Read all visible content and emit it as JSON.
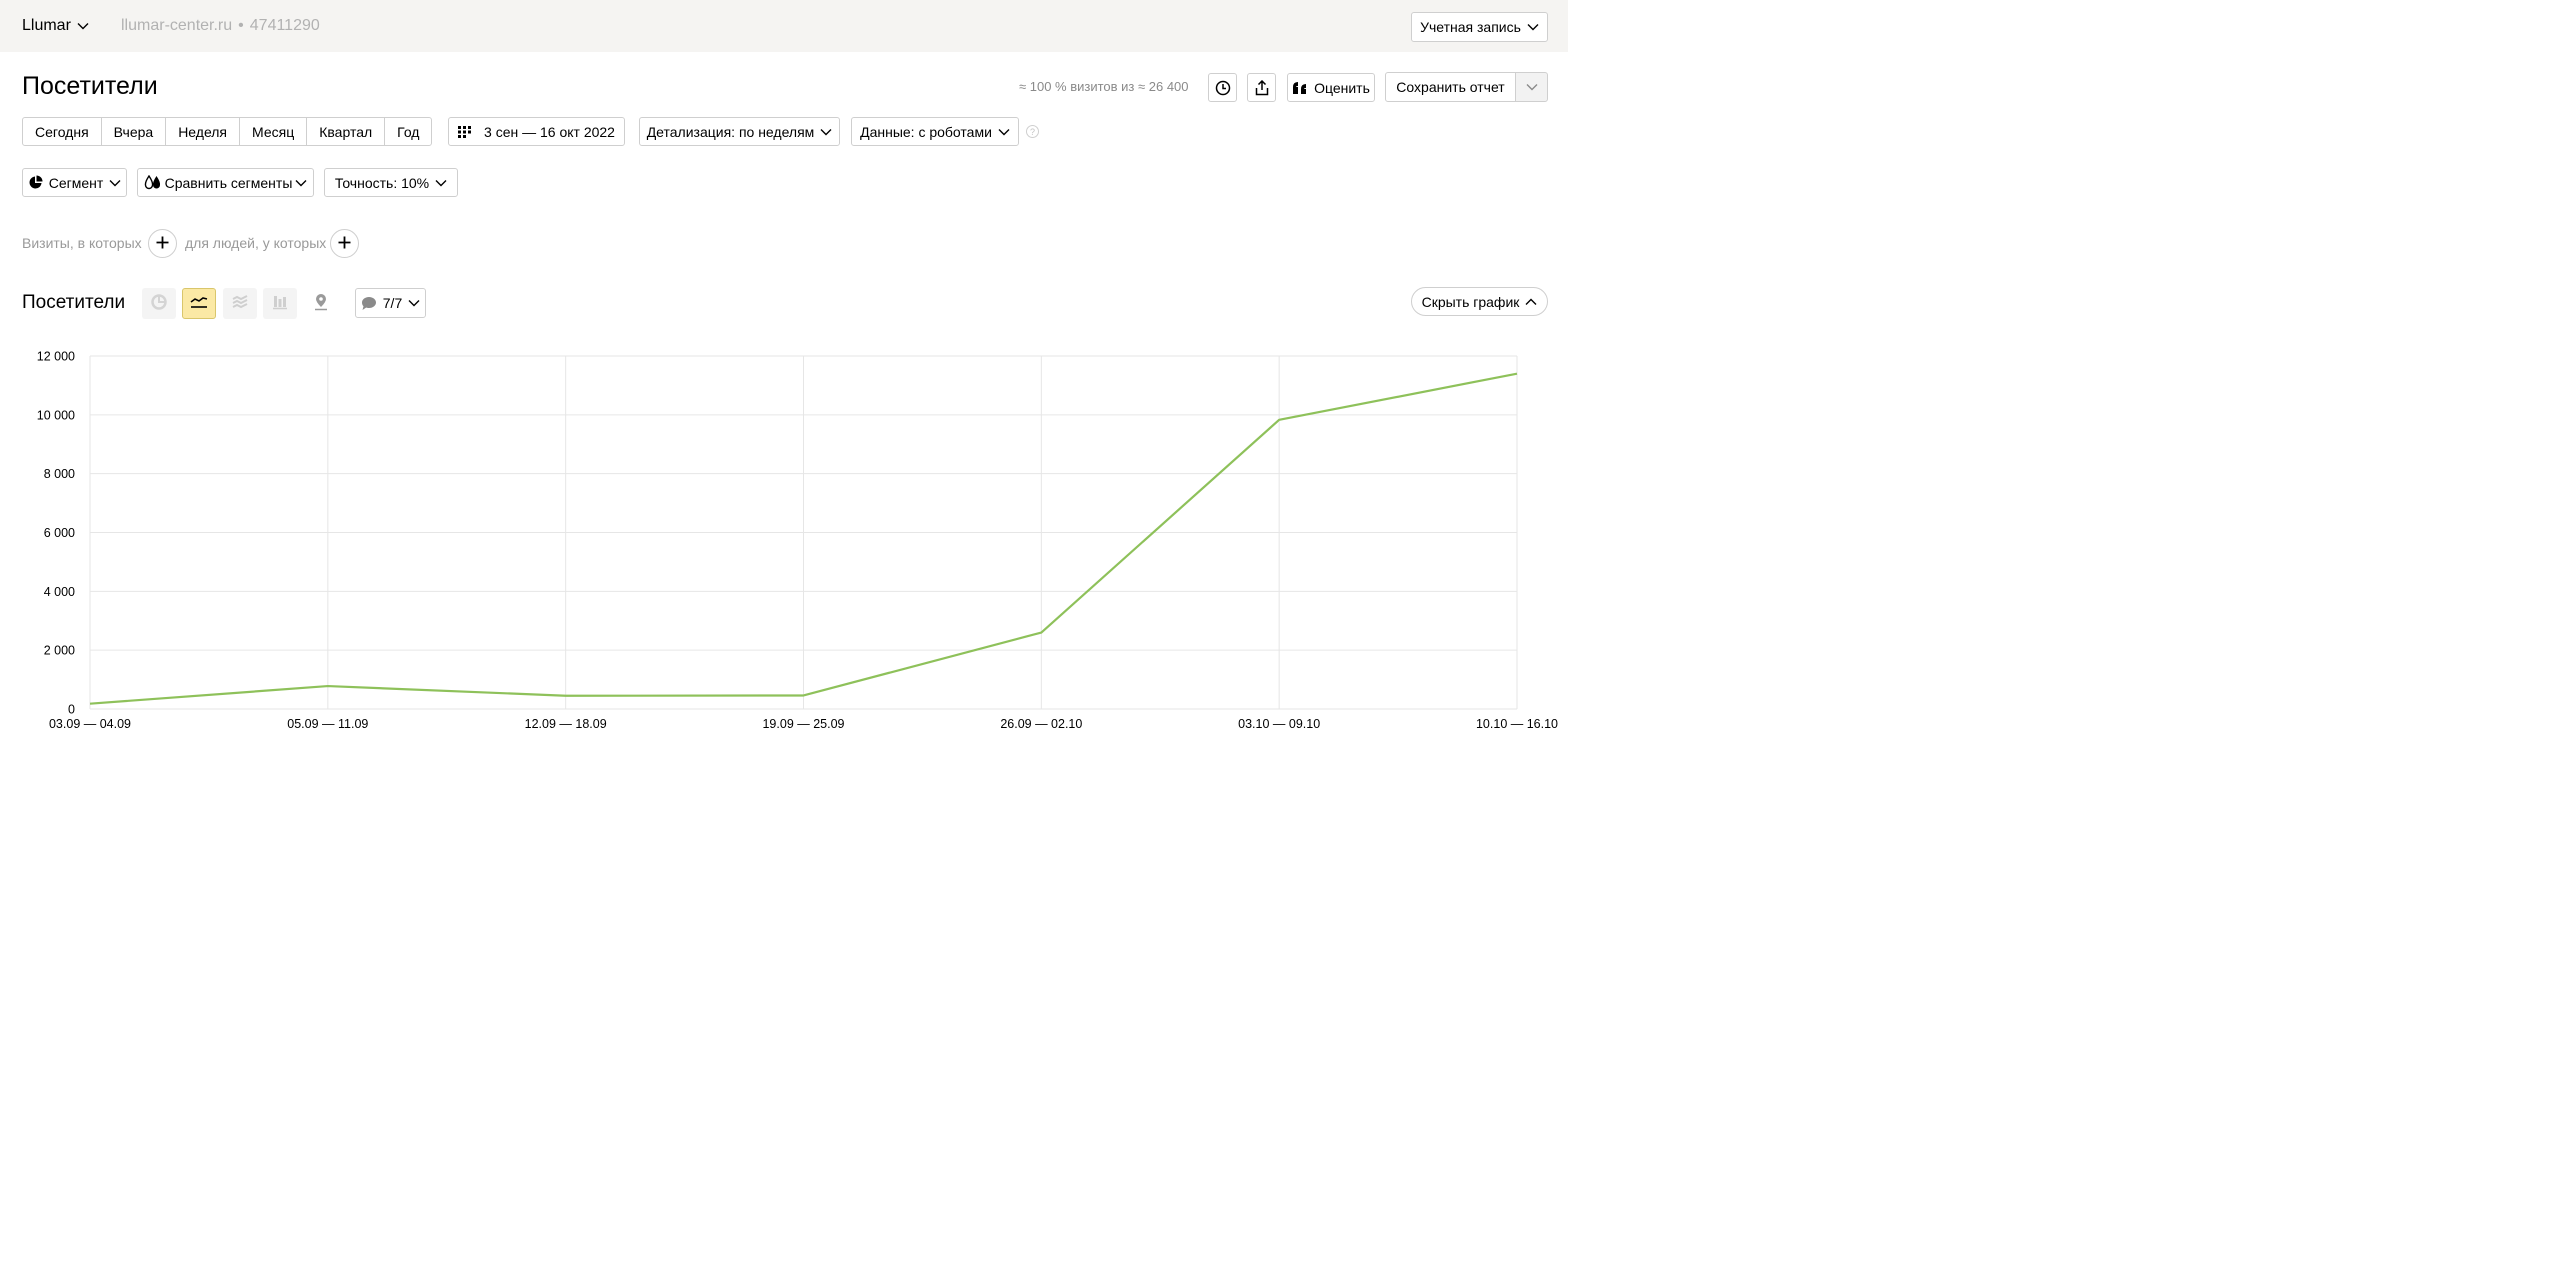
{
  "header": {
    "counter_name": "Llumar",
    "site": "llumar-center.ru",
    "separator": "•",
    "counter_id": "47411290",
    "account_label": "Учетная запись"
  },
  "page": {
    "title": "Посетители",
    "sample_info": "≈ 100 % визитов из ≈ 26 400",
    "rate_label": "Оценить",
    "save_report_label": "Сохранить отчет"
  },
  "periods": [
    "Сегодня",
    "Вчера",
    "Неделя",
    "Месяц",
    "Квартал",
    "Год"
  ],
  "date_range": "3 сен — 16 окт 2022",
  "detail_label": "Детализация: по неделям",
  "data_label": "Данные: с роботами",
  "help_symbol": "?",
  "segment_label": "Сегмент",
  "compare_label": "Сравнить сегменты",
  "accuracy_label": "Точность: 10%",
  "filters": {
    "visits_label": "Визиты, в которых",
    "people_label": "для людей, у которых"
  },
  "chart_section": {
    "title": "Посетители",
    "annotations_label": "7/7",
    "hide_chart_label": "Скрыть график"
  },
  "icons": {
    "view_pie": "pie-chart-icon",
    "view_line": "line-chart-icon",
    "view_area": "stacked-area-icon",
    "view_bar": "bar-chart-icon",
    "view_map": "map-pin-icon",
    "annotations": "comment-icon",
    "history": "clock-icon",
    "share": "share-icon",
    "rate": "quote-icon",
    "calendar": "calendar-grid-icon"
  },
  "colors": {
    "line": "#8ec15a",
    "active_view_bg": "#fbe9a5",
    "header_bg": "#f5f4f2",
    "grid": "#e6e6e6"
  },
  "chart_data": {
    "type": "line",
    "categories": [
      "03.09 — 04.09",
      "05.09 — 11.09",
      "12.09 — 18.09",
      "19.09 — 25.09",
      "26.09 — 02.10",
      "03.10 — 09.10",
      "10.10 — 16.10"
    ],
    "series": [
      {
        "values": [
          180,
          780,
          450,
          460,
          2600,
          9830,
          11400
        ]
      }
    ],
    "ylim": [
      0,
      12000
    ],
    "yticks": [
      0,
      2000,
      4000,
      6000,
      8000,
      10000,
      12000
    ],
    "ytick_labels": [
      "0",
      "2 000",
      "4 000",
      "6 000",
      "8 000",
      "10 000",
      "12 000"
    ],
    "grid": true
  }
}
